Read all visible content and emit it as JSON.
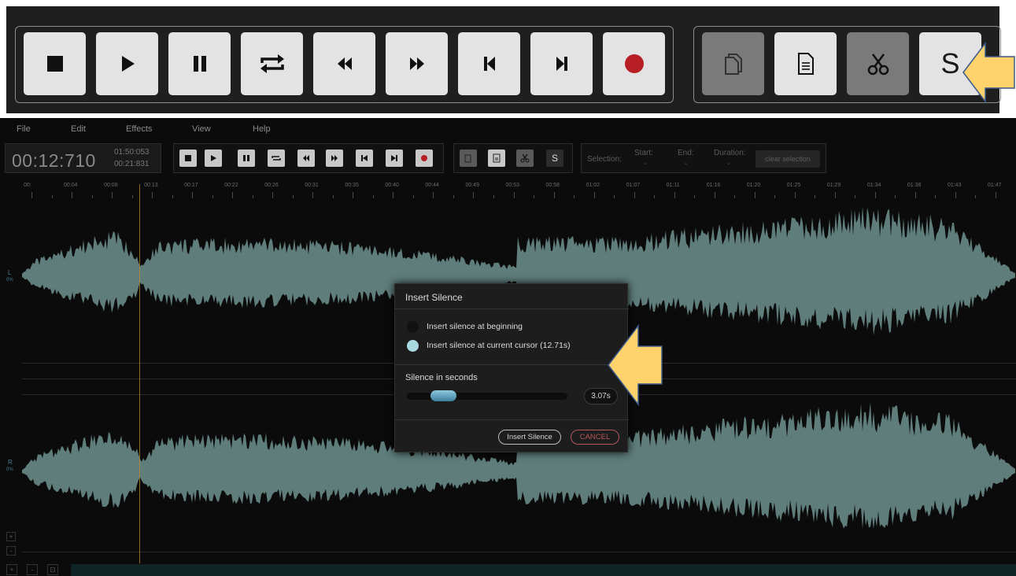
{
  "zoom_toolbar": {
    "transport_buttons": [
      {
        "name": "stop-button",
        "icon": "stop-icon"
      },
      {
        "name": "play-button",
        "icon": "play-icon"
      },
      {
        "name": "pause-button",
        "icon": "pause-icon"
      },
      {
        "name": "loop-button",
        "icon": "loop-icon"
      },
      {
        "name": "rewind-button",
        "icon": "rewind-icon"
      },
      {
        "name": "fast-forward-button",
        "icon": "fast-forward-icon"
      },
      {
        "name": "skip-to-start-button",
        "icon": "skip-start-icon"
      },
      {
        "name": "skip-to-end-button",
        "icon": "skip-end-icon"
      },
      {
        "name": "record-button",
        "icon": "record-icon"
      }
    ],
    "edit_buttons": [
      {
        "name": "copy-button",
        "icon": "copy-icon",
        "enabled": false
      },
      {
        "name": "paste-button",
        "icon": "paste-icon",
        "enabled": true
      },
      {
        "name": "cut-button",
        "icon": "scissors-icon",
        "enabled": false
      },
      {
        "name": "insert-silence-tool-button",
        "icon": "silence-icon",
        "enabled": true
      }
    ],
    "silence_letter": "S",
    "highlight_arrow_color": "#ffd36b"
  },
  "menu": [
    "File",
    "Edit",
    "Effects",
    "View",
    "Help"
  ],
  "time": {
    "current": "00:12:710",
    "total": "01:50:053",
    "selection": "00:21:831"
  },
  "selection": {
    "label": "Selection:",
    "start_label": "Start:",
    "start_value": "-",
    "end_label": "End:",
    "end_value": "-",
    "duration_label": "Duration:",
    "duration_value": "-",
    "clear_label": "clear selection"
  },
  "ruler_labels": [
    "00:",
    "00:04",
    "00:08",
    "00:13",
    "00:17",
    "00:22",
    "00:26",
    "00:31",
    "00:35",
    "00:40",
    "00:44",
    "00:49",
    "00:53",
    "00:58",
    "01:02",
    "01:07",
    "01:11",
    "01:16",
    "01:20",
    "01:25",
    "01:29",
    "01:34",
    "01:38",
    "01:43",
    "01:47"
  ],
  "channels": {
    "left_label": "L",
    "left_sub": "0%",
    "right_label": "R",
    "right_sub": "0%",
    "waveform_color": "#5e7d7b"
  },
  "side_controls": [
    "+",
    "-"
  ],
  "bottom_controls": [
    "+",
    "-",
    "⊡"
  ],
  "dialog": {
    "title": "Insert Silence",
    "option_beginning": "Insert silence at beginning",
    "option_cursor": "Insert silence at current cursor (12.71s)",
    "selected_option": "cursor",
    "silence_label": "Silence in seconds",
    "silence_value": "3.07s",
    "silence_slider_fraction": 0.15,
    "insert_button": "Insert Silence",
    "cancel_button": "CANCEL"
  }
}
